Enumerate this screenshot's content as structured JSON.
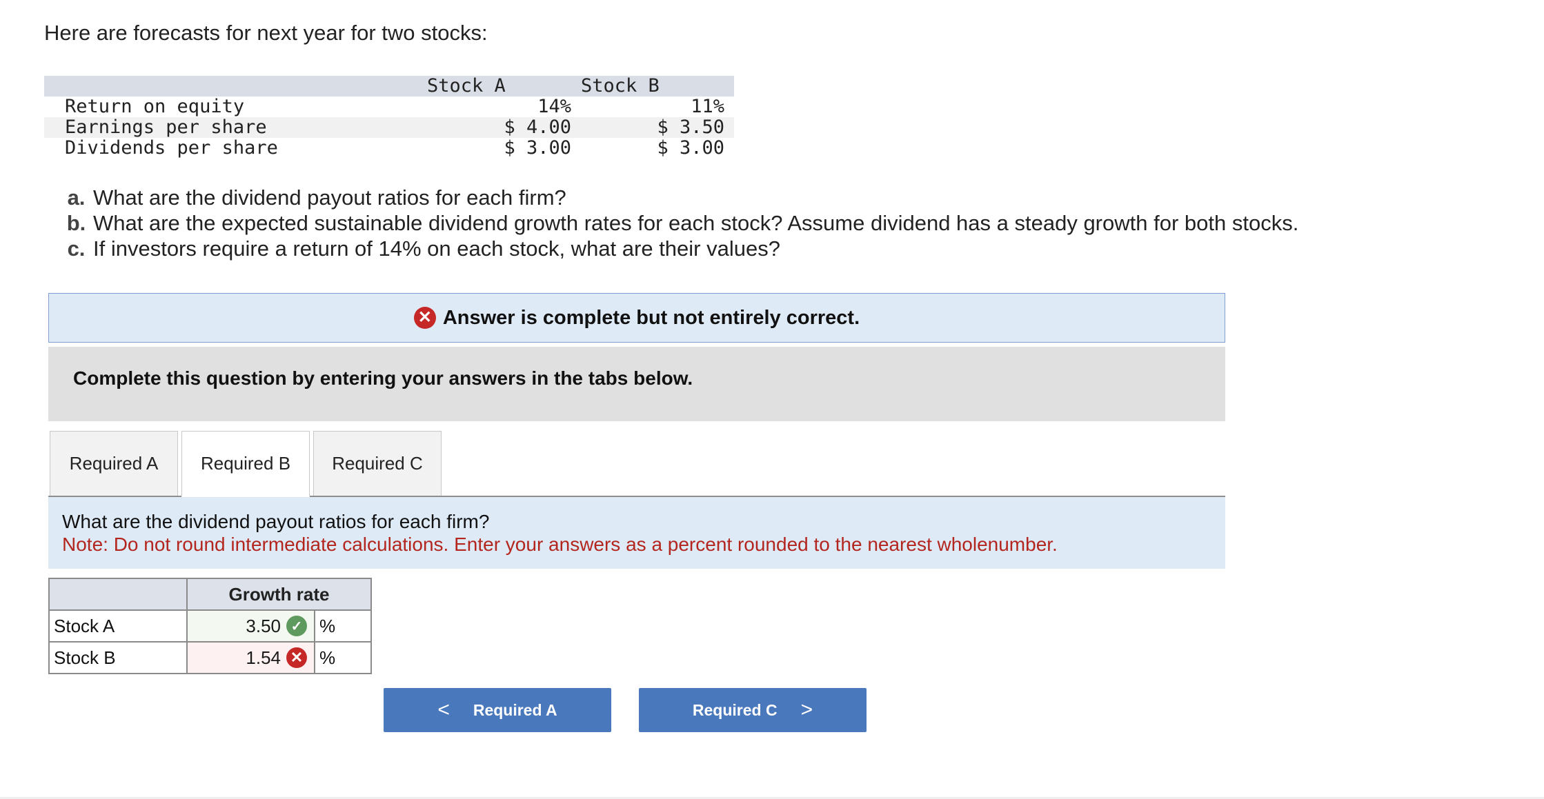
{
  "intro": "Here are forecasts for next year for two stocks:",
  "forecast": {
    "headers": [
      "Stock A",
      "Stock B"
    ],
    "rows": [
      {
        "label": "Return on equity",
        "a": "14%",
        "b": "11%"
      },
      {
        "label": "Earnings per share",
        "a": "$ 4.00",
        "b": "$ 3.50"
      },
      {
        "label": "Dividends per share",
        "a": "$ 3.00",
        "b": "$ 3.00"
      }
    ]
  },
  "questions": [
    {
      "letter": "a.",
      "text": "What are the dividend payout ratios for each firm?"
    },
    {
      "letter": "b.",
      "text": "What are the expected sustainable dividend growth rates for each stock? Assume dividend has a steady growth for both stocks."
    },
    {
      "letter": "c.",
      "text": "If investors require a return of 14% on each stock, what are their values?"
    }
  ],
  "banner": {
    "icon": "x-circle-icon",
    "text": "Answer is complete but not entirely correct."
  },
  "instruction": "Complete this question by entering your answers in the tabs below.",
  "tabs": [
    {
      "label": "Required A",
      "active": false
    },
    {
      "label": "Required B",
      "active": true
    },
    {
      "label": "Required C",
      "active": false
    }
  ],
  "panel": {
    "question": "What are the dividend payout ratios for each firm?",
    "note": "Note: Do not round intermediate calculations. Enter your answers as a percent rounded to the nearest wholenumber."
  },
  "answer_table": {
    "header": "Growth rate",
    "rows": [
      {
        "label": "Stock A",
        "value": "3.50",
        "unit": "%",
        "status": "correct"
      },
      {
        "label": "Stock B",
        "value": "1.54",
        "unit": "%",
        "status": "incorrect"
      }
    ]
  },
  "nav": {
    "prev_label": "Required A",
    "next_label": "Required C",
    "prev_glyph": "<",
    "next_glyph": ">"
  },
  "colors": {
    "accent": "#4a78bd",
    "error": "#c62828",
    "success": "#5e9a5e",
    "note": "#b3261e"
  }
}
